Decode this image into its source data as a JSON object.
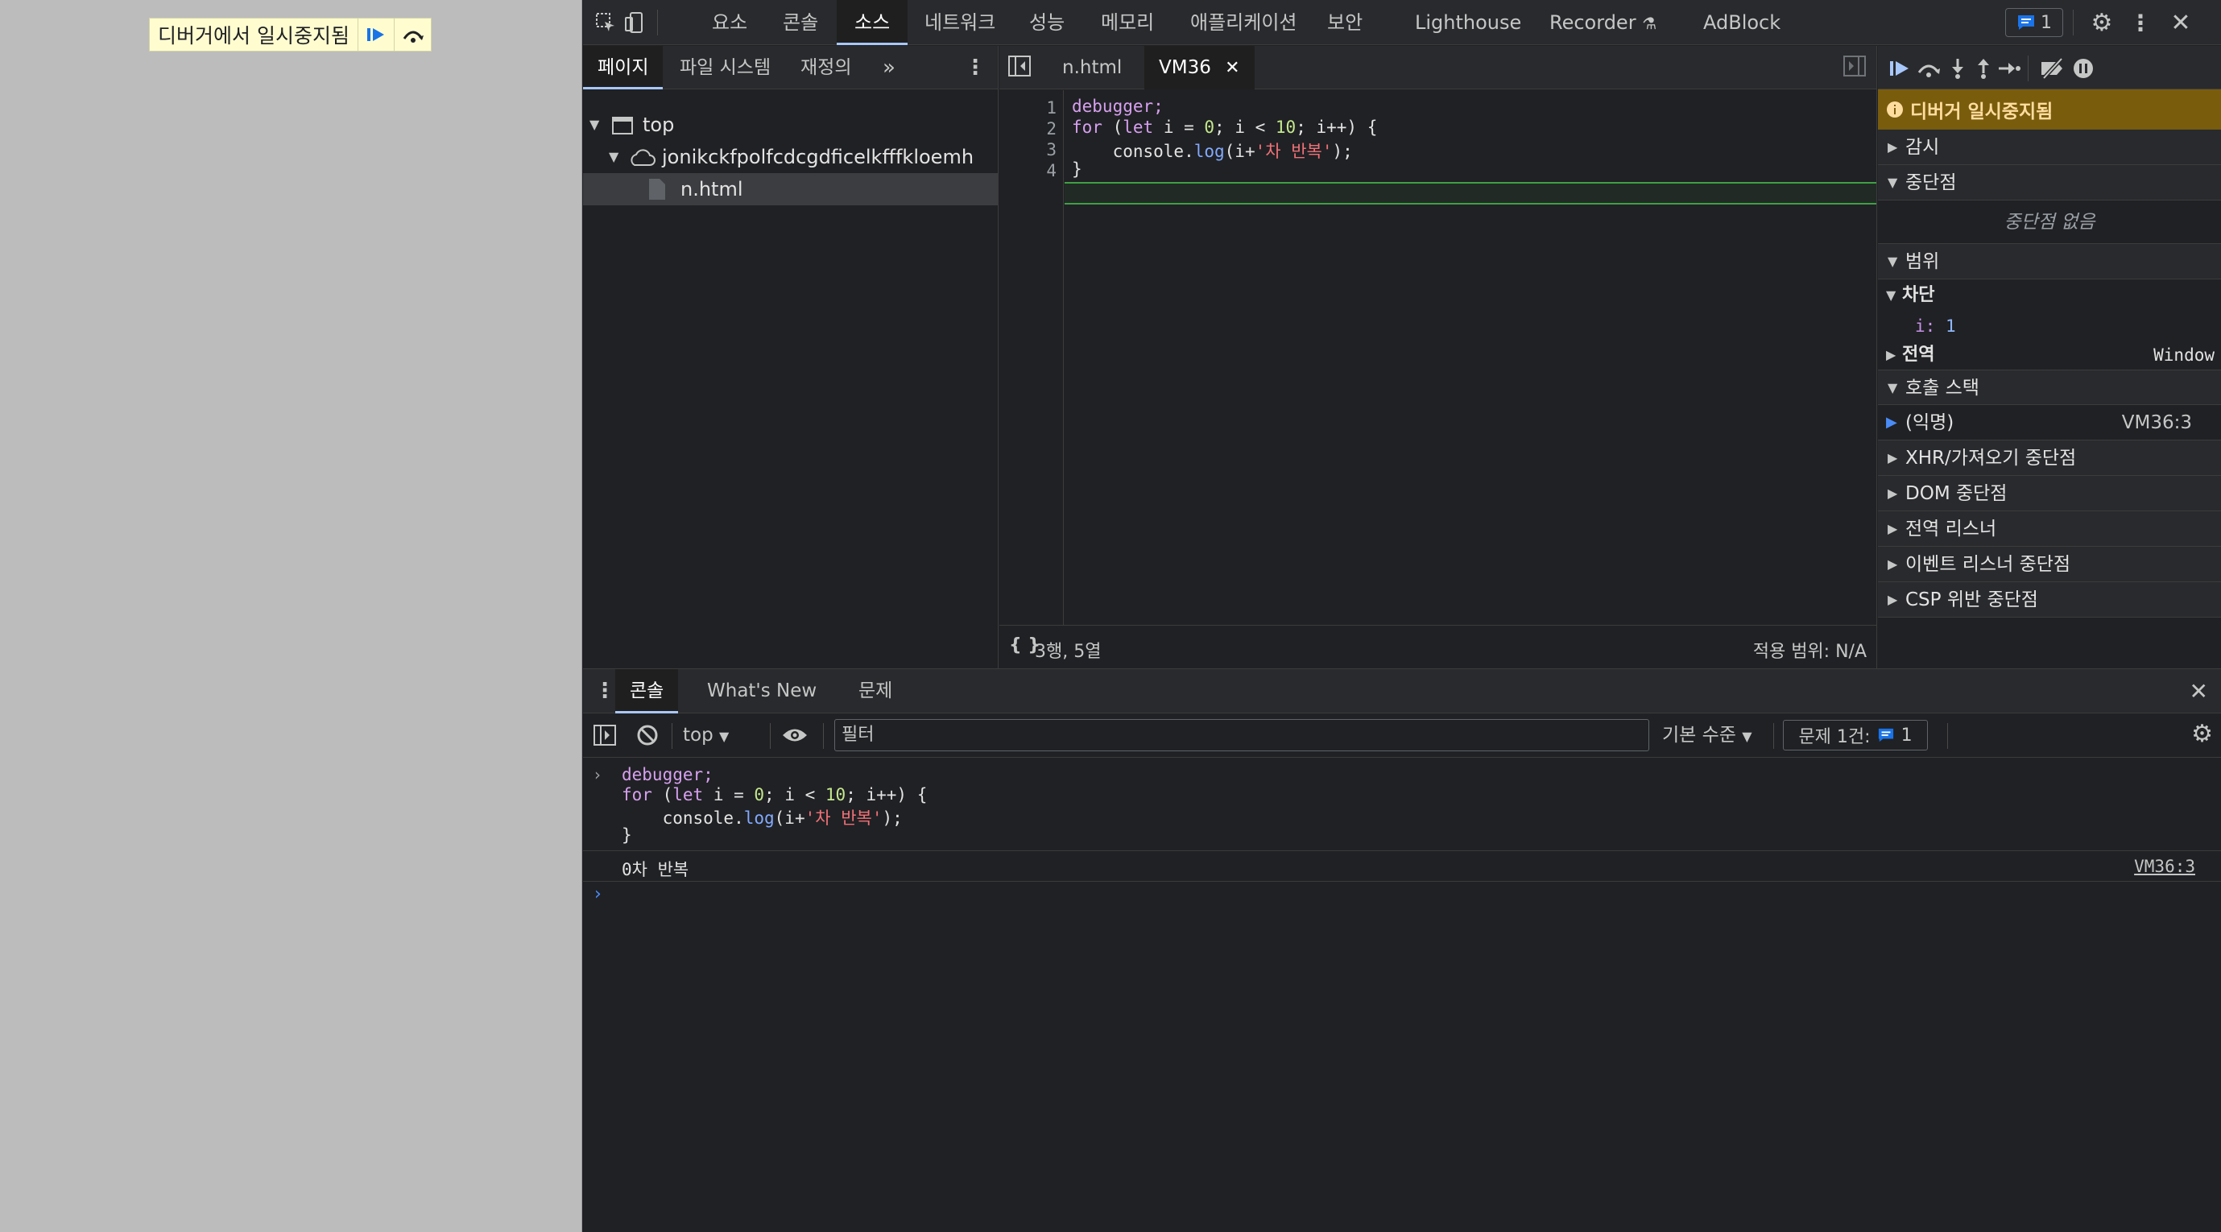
{
  "page": {
    "banner_text": "디버거에서 일시중지됨",
    "resume_icon": "resume-icon",
    "step_over_icon": "step-over-icon"
  },
  "toolbar": {
    "tabs": [
      "요소",
      "콘솔",
      "소스",
      "네트워크",
      "성능",
      "메모리",
      "애플리케이션",
      "보안",
      "Lighthouse",
      "Recorder",
      "AdBlock"
    ],
    "active_tab": "소스",
    "issues_count": "1"
  },
  "navigator": {
    "tabs": [
      "페이지",
      "파일 시스템",
      "재정의"
    ],
    "active_tab": "페이지",
    "tree": {
      "top": "top",
      "origin": "jonikckfpolfcdcgdficelkfffkloemh",
      "file": "n.html"
    }
  },
  "editor": {
    "tabs": [
      "n.html",
      "VM36"
    ],
    "active_tab": "VM36",
    "lines": [
      {
        "n": "1"
      },
      {
        "n": "2"
      },
      {
        "n": "3"
      },
      {
        "n": "4"
      }
    ],
    "code": {
      "l1": "debugger;",
      "l2_kw": "for",
      "l2_a": " (",
      "l2_let": "let",
      "l2_b": " i = ",
      "l2_zero": "0",
      "l2_c": "; i < ",
      "l2_ten": "10",
      "l2_d": "; i++) {",
      "l3_a": "    console.",
      "l3_fn": "log",
      "l3_b": "(i+",
      "l3_str": "'차 반복'",
      "l3_c": ");",
      "l4": "}"
    },
    "status_position": "3행, 5열",
    "status_coverage": "적용 범위: N/A",
    "format_label": "{ }"
  },
  "debugger": {
    "paused_message": "디버거 일시중지됨",
    "sections": {
      "watch": "감시",
      "breakpoints": "중단점",
      "no_breakpoints": "중단점 없음",
      "scope": "범위",
      "block": "차단",
      "var_name": "i",
      "var_value": "1",
      "global": "전역",
      "global_value": "Window",
      "call_stack": "호출 스택",
      "frame_name": "(익명)",
      "frame_loc": "VM36:3",
      "xhr": "XHR/가져오기 중단점",
      "dom": "DOM 중단점",
      "global_listeners": "전역 리스너",
      "event_listeners": "이벤트 리스너 중단점",
      "csp": "CSP 위반 중단점"
    }
  },
  "drawer": {
    "tabs": [
      "콘솔",
      "What's New",
      "문제"
    ],
    "active_tab": "콘솔",
    "context": "top",
    "filter_placeholder": "필터",
    "level": "기본 수준",
    "issues_label": "문제 1건:",
    "issues_count": "1",
    "console": {
      "in1": "debugger;",
      "in2_kw": "for",
      "in2_a": " (",
      "in2_let": "let",
      "in2_b": " i = ",
      "in2_zero": "0",
      "in2_c": "; i < ",
      "in2_ten": "10",
      "in2_d": "; i++) {",
      "in3_a": "    console.",
      "in3_fn": "log",
      "in3_b": "(i+",
      "in3_str": "'차 반복'",
      "in3_c": ");",
      "in4": "}",
      "out": "0차 반복",
      "out_link": "VM36:3"
    }
  },
  "colors": {
    "banner_bg": "#fffdd0",
    "paused_bg": "#7a5c0d",
    "accent": "#a8c7fa",
    "exec_line": "#3f9f45"
  }
}
